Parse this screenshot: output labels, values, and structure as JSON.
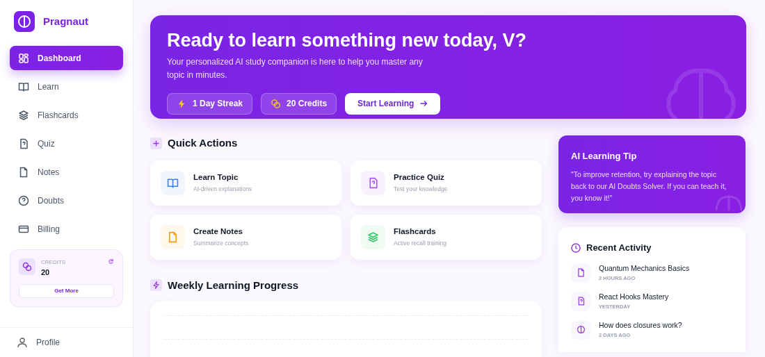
{
  "brand": {
    "name": "Pragnaut"
  },
  "sidebar": {
    "items": [
      {
        "label": "Dashboard",
        "selected": true
      },
      {
        "label": "Learn",
        "selected": false
      },
      {
        "label": "Flashcards",
        "selected": false
      },
      {
        "label": "Quiz",
        "selected": false
      },
      {
        "label": "Notes",
        "selected": false
      },
      {
        "label": "Doubts",
        "selected": false
      },
      {
        "label": "Billing",
        "selected": false
      }
    ],
    "credits": {
      "label": "CREDITS",
      "value": "20",
      "button": "Get More"
    },
    "profile": "Profile"
  },
  "hero": {
    "title": "Ready to learn something new today, V?",
    "subtitle": "Your personalized AI study companion is here to help you master any topic in minutes.",
    "badges": [
      "1 Day Streak",
      "20 Credits"
    ],
    "button": "Start Learning"
  },
  "quick_actions": {
    "title": "Quick Actions",
    "items": [
      {
        "title": "Learn Topic",
        "subtitle": "AI-driven explanations",
        "color": "#3b82f6"
      },
      {
        "title": "Practice Quiz",
        "subtitle": "Test your knowledge",
        "color": "#a855f7"
      },
      {
        "title": "Create Notes",
        "subtitle": "Summarize concepts",
        "color": "#f59e0b"
      },
      {
        "title": "Flashcards",
        "subtitle": "Active recall training",
        "color": "#22c55e"
      }
    ]
  },
  "weekly_progress": {
    "title": "Weekly Learning Progress"
  },
  "tip": {
    "title": "AI Learning Tip",
    "text": "\"To improve retention, try explaining the topic back to our AI Doubts Solver. If you can teach it, you know it!\""
  },
  "recent_activity": {
    "title": "Recent Activity",
    "items": [
      {
        "title": "Quantum Mechanics Basics",
        "time": "2 HOURS AGO"
      },
      {
        "title": "React Hooks Mastery",
        "time": "YESTERDAY"
      },
      {
        "title": "How does closures work?",
        "time": "2 DAYS AGO"
      }
    ]
  }
}
